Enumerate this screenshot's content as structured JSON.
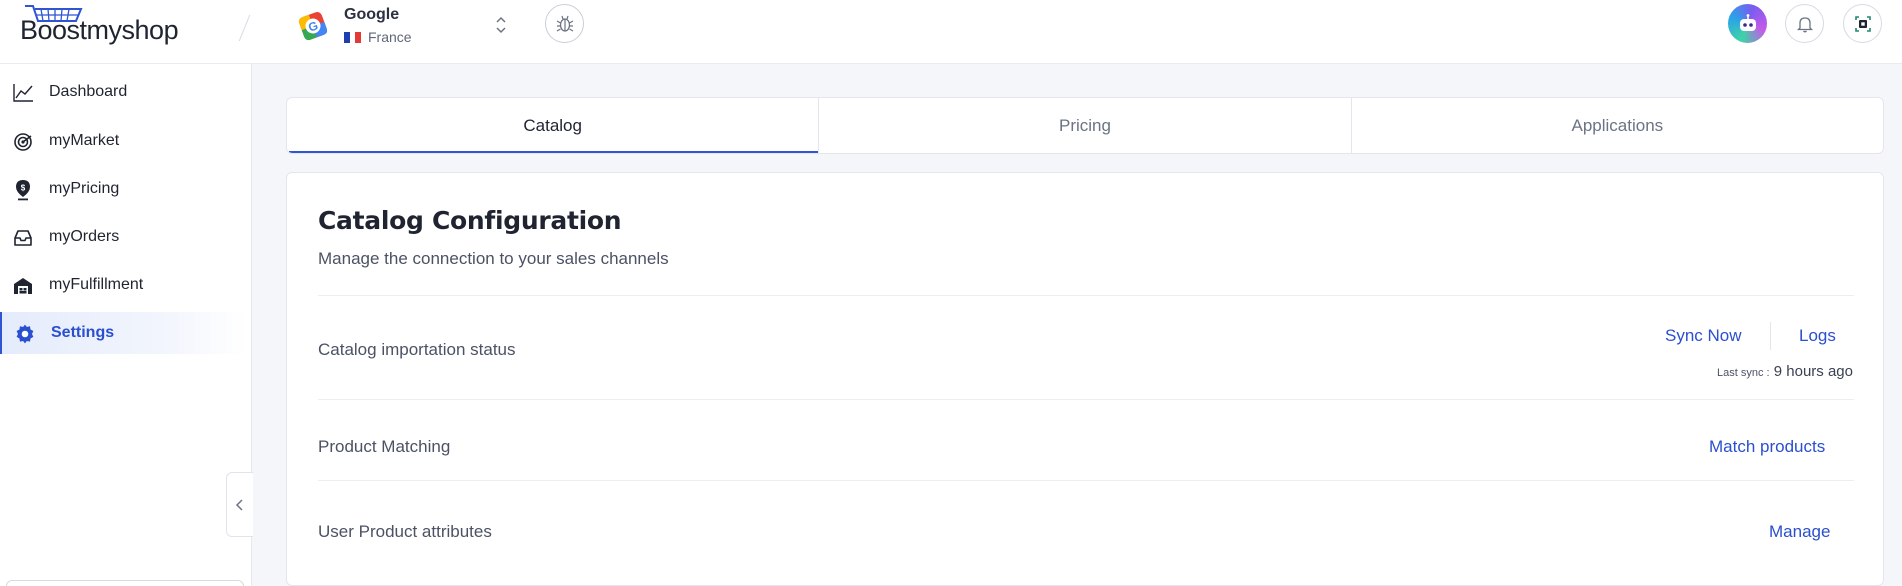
{
  "header": {
    "logo_text": "Boostmyshop",
    "store": {
      "name": "Google",
      "country": "France"
    },
    "icons": [
      "cart-logo-icon",
      "google-icon",
      "france-flag-icon",
      "chevron-updown-icon",
      "bug-icon",
      "chatbot-avatar-icon",
      "bell-icon",
      "app-frame-icon"
    ]
  },
  "sidebar": {
    "items": [
      {
        "label": "Dashboard",
        "icon": "chart-line-icon"
      },
      {
        "label": "myMarket",
        "icon": "radar-icon"
      },
      {
        "label": "myPricing",
        "icon": "price-pin-icon"
      },
      {
        "label": "myOrders",
        "icon": "inbox-icon"
      },
      {
        "label": "myFulfillment",
        "icon": "warehouse-icon"
      },
      {
        "label": "Settings",
        "icon": "gear-icon",
        "active": true
      }
    ]
  },
  "tabs": [
    {
      "label": "Catalog",
      "active": true
    },
    {
      "label": "Pricing"
    },
    {
      "label": "Applications"
    }
  ],
  "catalog": {
    "title": "Catalog Configuration",
    "subtitle": "Manage the connection to your sales channels",
    "rows": {
      "importation": {
        "label": "Catalog importation status",
        "sync_label": "Sync Now",
        "logs_label": "Logs",
        "last_sync_prefix": "Last sync :",
        "last_sync_value": "9 hours ago"
      },
      "matching": {
        "label": "Product Matching",
        "action": "Match products"
      },
      "attributes": {
        "label": "User Product attributes",
        "action": "Manage"
      }
    }
  },
  "colors": {
    "accent": "#2a4fcf",
    "background": "#f5f6fa",
    "text": "#1f2430"
  }
}
